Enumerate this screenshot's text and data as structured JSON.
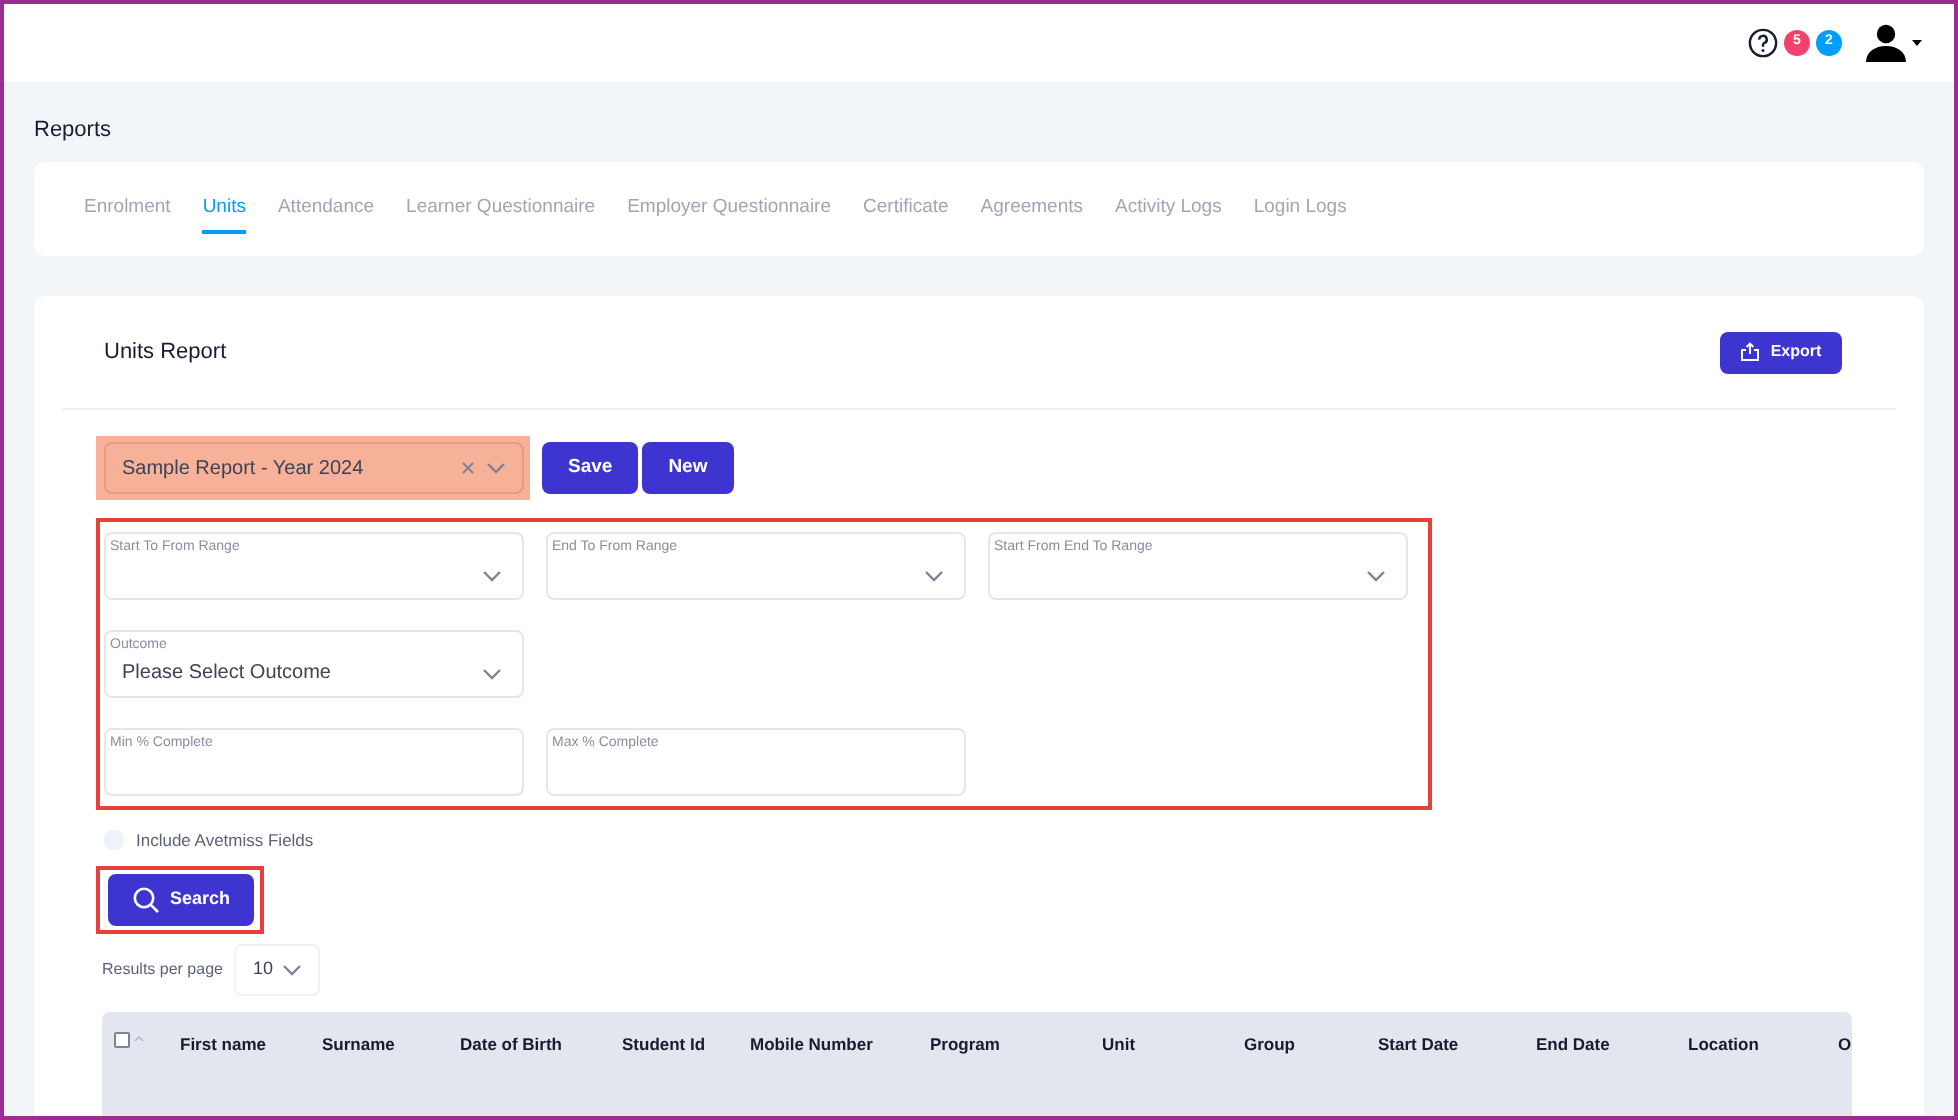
{
  "header": {
    "notifications": [
      {
        "count": "5",
        "color": "#f1416c"
      },
      {
        "count": "2",
        "color": "#009ef7"
      }
    ]
  },
  "page_title": "Reports",
  "tabs": [
    {
      "label": "Enrolment",
      "selected": false
    },
    {
      "label": "Units",
      "selected": true
    },
    {
      "label": "Attendance",
      "selected": false
    },
    {
      "label": "Learner Questionnaire",
      "selected": false
    },
    {
      "label": "Employer Questionnaire",
      "selected": false
    },
    {
      "label": "Certificate",
      "selected": false
    },
    {
      "label": "Agreements",
      "selected": false
    },
    {
      "label": "Activity Logs",
      "selected": false
    },
    {
      "label": "Login Logs",
      "selected": false
    }
  ],
  "report": {
    "title": "Units Report",
    "export_button": "Export",
    "saved_report": {
      "value": "Sample Report - Year 2024"
    },
    "buttons": [
      "Save",
      "New"
    ],
    "filter_rows": [
      [
        {
          "label": "Start To From Range",
          "kind": "select"
        },
        {
          "label": "End To From Range",
          "kind": "select"
        },
        {
          "label": "Start From End To Range",
          "kind": "select"
        }
      ],
      [
        {
          "label": "Outcome",
          "kind": "select",
          "value": "Please Select Outcome"
        }
      ],
      [
        {
          "label": "Min % Complete",
          "kind": "input"
        },
        {
          "label": "Max % Complete",
          "kind": "input"
        }
      ]
    ],
    "include_avetmiss": {
      "label": "Include Avetmiss Fields",
      "checked": false
    },
    "search_button": "Search",
    "results_per_page": {
      "label": "Results per page",
      "value": "10"
    },
    "table": {
      "select_all_checked": false,
      "columns": [
        "First name",
        "Surname",
        "Date of Birth",
        "Student Id",
        "Mobile Number",
        "Program",
        "Unit",
        "Group",
        "Start Date",
        "End Date",
        "Location",
        "O"
      ]
    }
  }
}
